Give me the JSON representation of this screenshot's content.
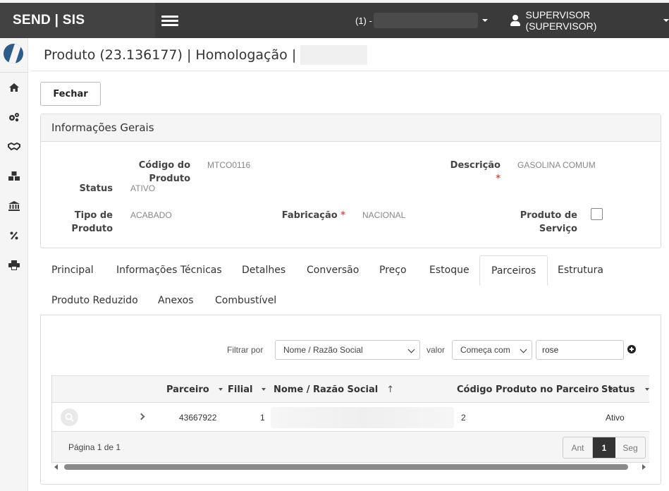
{
  "topbar": {
    "brand": "SEND | SIS",
    "company": "(1) -",
    "user": "SUPERVISOR (SUPERVISOR)"
  },
  "page": {
    "title": "Produto (23.136177) | Homologação |",
    "close_label": "Fechar"
  },
  "panel": {
    "title": "Informações Gerais",
    "fields": {
      "codigo_label": "Código do Produto",
      "codigo_value": "MTCO0116",
      "descricao_label": "Descrição",
      "descricao_value": "GASOLINA COMUM",
      "status_label": "Status",
      "status_value": "ATIVO",
      "tipo_label_1": "Tipo de",
      "tipo_label_2": "Produto",
      "tipo_value": "ACABADO",
      "fabricacao_label": "Fabricação",
      "fabricacao_value": "NACIONAL",
      "servico_label_1": "Produto de",
      "servico_label_2": "Serviço",
      "required_mark": "*"
    }
  },
  "tabs": [
    {
      "label": "Principal"
    },
    {
      "label": "Informações Técnicas"
    },
    {
      "label": "Detalhes"
    },
    {
      "label": "Conversão"
    },
    {
      "label": "Preço"
    },
    {
      "label": "Estoque"
    },
    {
      "label": "Parceiros"
    },
    {
      "label": "Estrutura"
    },
    {
      "label": "Produto Reduzido"
    },
    {
      "label": "Anexos"
    },
    {
      "label": "Combustível"
    }
  ],
  "filter": {
    "filter_by_label": "Filtrar por",
    "field_selected": "Nome / Razão Social",
    "value_label": "valor",
    "operator_selected": "Começa com",
    "search_value": "rose"
  },
  "grid": {
    "headers": {
      "parceiro": "Parceiro",
      "filial": "Filial",
      "nome": "Nome / Razão Social",
      "codigo": "Código Produto no Parceiro",
      "status": "Status"
    },
    "rows": [
      {
        "parceiro": "43667922",
        "filial": "1",
        "codigo": "2",
        "status": "Ativo"
      }
    ],
    "pagination": {
      "info": "Página 1 de 1",
      "prev": "Ant",
      "current": "1",
      "next": "Seg"
    }
  }
}
